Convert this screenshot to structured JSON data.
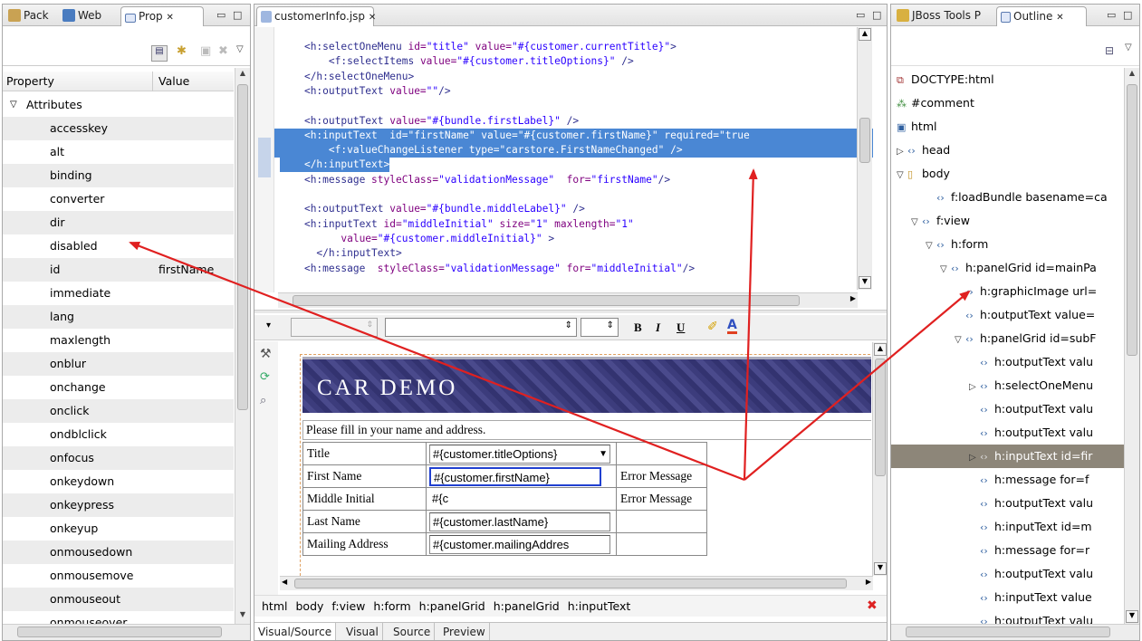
{
  "left_panel": {
    "tabs": [
      {
        "label": "Pack"
      },
      {
        "label": "Web"
      },
      {
        "label": "Prop"
      }
    ],
    "columns": {
      "property": "Property",
      "value": "Value"
    },
    "group": "Attributes",
    "rows": [
      {
        "name": "accesskey",
        "value": ""
      },
      {
        "name": "alt",
        "value": ""
      },
      {
        "name": "binding",
        "value": ""
      },
      {
        "name": "converter",
        "value": ""
      },
      {
        "name": "dir",
        "value": ""
      },
      {
        "name": "disabled",
        "value": ""
      },
      {
        "name": "id",
        "value": "firstName"
      },
      {
        "name": "immediate",
        "value": ""
      },
      {
        "name": "lang",
        "value": ""
      },
      {
        "name": "maxlength",
        "value": ""
      },
      {
        "name": "onblur",
        "value": ""
      },
      {
        "name": "onchange",
        "value": ""
      },
      {
        "name": "onclick",
        "value": ""
      },
      {
        "name": "ondblclick",
        "value": ""
      },
      {
        "name": "onfocus",
        "value": ""
      },
      {
        "name": "onkeydown",
        "value": ""
      },
      {
        "name": "onkeypress",
        "value": ""
      },
      {
        "name": "onkeyup",
        "value": ""
      },
      {
        "name": "onmousedown",
        "value": ""
      },
      {
        "name": "onmousemove",
        "value": ""
      },
      {
        "name": "onmouseout",
        "value": ""
      },
      {
        "name": "onmouseover",
        "value": ""
      }
    ]
  },
  "editor": {
    "tab": "customerInfo.jsp",
    "source_lines": [
      {
        "sel": false,
        "parts": [
          [
            "pl",
            "    "
          ],
          [
            "tg",
            "<h:selectOneMenu "
          ],
          [
            "at",
            "id="
          ],
          [
            "sv",
            "\"title\" "
          ],
          [
            "at",
            "value="
          ],
          [
            "sv",
            "\"#{customer.currentTitle}\""
          ],
          [
            "tg",
            ">"
          ]
        ]
      },
      {
        "sel": false,
        "parts": [
          [
            "pl",
            "        "
          ],
          [
            "tg",
            "<f:selectItems "
          ],
          [
            "at",
            "value="
          ],
          [
            "sv",
            "\"#{customer.titleOptions}\" "
          ],
          [
            "tg",
            "/>"
          ]
        ]
      },
      {
        "sel": false,
        "parts": [
          [
            "pl",
            "    "
          ],
          [
            "tg",
            "</h:selectOneMenu>"
          ]
        ]
      },
      {
        "sel": false,
        "parts": [
          [
            "pl",
            "    "
          ],
          [
            "tg",
            "<h:outputText "
          ],
          [
            "at",
            "value="
          ],
          [
            "sv",
            "\"\""
          ],
          [
            "tg",
            "/>"
          ]
        ]
      },
      {
        "sel": false,
        "parts": [
          [
            "pl",
            " "
          ]
        ]
      },
      {
        "sel": false,
        "parts": [
          [
            "pl",
            "    "
          ],
          [
            "tg",
            "<h:outputText "
          ],
          [
            "at",
            "value="
          ],
          [
            "sv",
            "\"#{bundle.firstLabel}\" "
          ],
          [
            "tg",
            "/>"
          ]
        ]
      },
      {
        "sel": true,
        "parts": [
          [
            "pl",
            "    "
          ],
          [
            "tg",
            "<h:inputText  "
          ],
          [
            "at",
            "id="
          ],
          [
            "sv",
            "\"firstName\" "
          ],
          [
            "at",
            "value="
          ],
          [
            "sv",
            "\"#{customer.firstName}\" "
          ],
          [
            "at",
            "required="
          ],
          [
            "sv",
            "\"true"
          ]
        ]
      },
      {
        "sel": true,
        "parts": [
          [
            "pl",
            "        "
          ],
          [
            "tg",
            "<f:valueChangeListener "
          ],
          [
            "at",
            "type="
          ],
          [
            "sv",
            "\"carstore.FirstNameChanged\" "
          ],
          [
            "tg",
            "/>"
          ]
        ]
      },
      {
        "sel": "partial",
        "parts": [
          [
            "pl",
            "    "
          ],
          [
            "tg",
            "</h:inputText>"
          ]
        ]
      },
      {
        "sel": false,
        "parts": [
          [
            "pl",
            "    "
          ],
          [
            "tg",
            "<h:message "
          ],
          [
            "at",
            "styleClass="
          ],
          [
            "sv",
            "\"validationMessage\"  "
          ],
          [
            "at",
            "for="
          ],
          [
            "sv",
            "\"firstName\""
          ],
          [
            "tg",
            "/>"
          ]
        ]
      },
      {
        "sel": false,
        "parts": [
          [
            "pl",
            " "
          ]
        ]
      },
      {
        "sel": false,
        "parts": [
          [
            "pl",
            "    "
          ],
          [
            "tg",
            "<h:outputText "
          ],
          [
            "at",
            "value="
          ],
          [
            "sv",
            "\"#{bundle.middleLabel}\" "
          ],
          [
            "tg",
            "/>"
          ]
        ]
      },
      {
        "sel": false,
        "parts": [
          [
            "pl",
            "    "
          ],
          [
            "tg",
            "<h:inputText "
          ],
          [
            "at",
            "id="
          ],
          [
            "sv",
            "\"middleInitial\" "
          ],
          [
            "at",
            "size="
          ],
          [
            "sv",
            "\"1\" "
          ],
          [
            "at",
            "maxlength="
          ],
          [
            "sv",
            "\"1\""
          ]
        ]
      },
      {
        "sel": false,
        "parts": [
          [
            "pl",
            "          "
          ],
          [
            "at",
            "value="
          ],
          [
            "sv",
            "\"#{customer.middleInitial}\" "
          ],
          [
            "tg",
            ">"
          ]
        ]
      },
      {
        "sel": false,
        "parts": [
          [
            "pl",
            "      "
          ],
          [
            "tg",
            "</h:inputText>"
          ]
        ]
      },
      {
        "sel": false,
        "parts": [
          [
            "pl",
            "    "
          ],
          [
            "tg",
            "<h:message  "
          ],
          [
            "at",
            "styleClass="
          ],
          [
            "sv",
            "\"validationMessage\" "
          ],
          [
            "at",
            "for="
          ],
          [
            "sv",
            "\"middleInitial\""
          ],
          [
            "tg",
            "/>"
          ]
        ]
      }
    ],
    "toolbar": {
      "bold": "B",
      "italic": "I",
      "underline": "U"
    },
    "visual": {
      "banner": "CAR DEMO",
      "intro": "Please fill in your name and address.",
      "rows": [
        {
          "label": "Title",
          "input": "#{customer.titleOptions}",
          "msg": ""
        },
        {
          "label": "First Name",
          "input": "#{customer.firstName}",
          "msg": "Error Message"
        },
        {
          "label": "Middle Initial",
          "input": "#{c",
          "msg": "Error Message"
        },
        {
          "label": "Last Name",
          "input": "#{customer.lastName}",
          "msg": ""
        },
        {
          "label": "Mailing Address",
          "input": "#{customer.mailingAddres",
          "msg": ""
        }
      ]
    },
    "breadcrumb": [
      "html",
      "body",
      "f:view",
      "h:form",
      "h:panelGrid",
      "h:panelGrid",
      "h:inputText"
    ],
    "bottom_tabs": [
      "Visual/Source",
      "Visual",
      "Source",
      "Preview"
    ]
  },
  "right_panel": {
    "tabs": [
      {
        "label": "JBoss Tools P"
      },
      {
        "label": "Outline"
      }
    ],
    "tree": [
      {
        "text": "DOCTYPE:html",
        "lvl": 0,
        "tw": "",
        "ic": "doc"
      },
      {
        "text": "#comment",
        "lvl": 0,
        "tw": "",
        "ic": "cmt"
      },
      {
        "text": "html",
        "lvl": 0,
        "tw": "",
        "ic": "html"
      },
      {
        "text": "head",
        "lvl": 0,
        "tw": "▷",
        "ic": "tag"
      },
      {
        "text": "body",
        "lvl": 0,
        "tw": "▽",
        "ic": "body"
      },
      {
        "text": "f:loadBundle basename=ca",
        "lvl": 2,
        "tw": "",
        "ic": "tag"
      },
      {
        "text": "f:view",
        "lvl": 1,
        "tw": "▽",
        "ic": "tag"
      },
      {
        "text": "h:form",
        "lvl": 2,
        "tw": "▽",
        "ic": "tag"
      },
      {
        "text": "h:panelGrid id=mainPa",
        "lvl": 3,
        "tw": "▽",
        "ic": "tag"
      },
      {
        "text": "h:graphicImage url=",
        "lvl": 4,
        "tw": "",
        "ic": "tag"
      },
      {
        "text": "h:outputText value=",
        "lvl": 4,
        "tw": "",
        "ic": "tag"
      },
      {
        "text": "h:panelGrid id=subF",
        "lvl": 4,
        "tw": "▽",
        "ic": "tag"
      },
      {
        "text": "h:outputText valu",
        "lvl": 5,
        "tw": "",
        "ic": "tag"
      },
      {
        "text": "h:selectOneMenu",
        "lvl": 5,
        "tw": "▷",
        "ic": "tag"
      },
      {
        "text": "h:outputText valu",
        "lvl": 5,
        "tw": "",
        "ic": "tag"
      },
      {
        "text": "h:outputText valu",
        "lvl": 5,
        "tw": "",
        "ic": "tag"
      },
      {
        "text": "h:inputText id=fir",
        "lvl": 5,
        "tw": "▷",
        "ic": "tag",
        "selected": true
      },
      {
        "text": "h:message for=f",
        "lvl": 5,
        "tw": "",
        "ic": "tag"
      },
      {
        "text": "h:outputText valu",
        "lvl": 5,
        "tw": "",
        "ic": "tag"
      },
      {
        "text": "h:inputText id=m",
        "lvl": 5,
        "tw": "",
        "ic": "tag"
      },
      {
        "text": "h:message for=r",
        "lvl": 5,
        "tw": "",
        "ic": "tag"
      },
      {
        "text": "h:outputText valu",
        "lvl": 5,
        "tw": "",
        "ic": "tag"
      },
      {
        "text": "h:inputText value",
        "lvl": 5,
        "tw": "",
        "ic": "tag"
      },
      {
        "text": "h:outputText valu",
        "lvl": 5,
        "tw": "",
        "ic": "tag"
      }
    ]
  },
  "colors": {
    "selection": "#4a87d4",
    "arrow": "#e02020",
    "banner": "#3a3a78"
  }
}
